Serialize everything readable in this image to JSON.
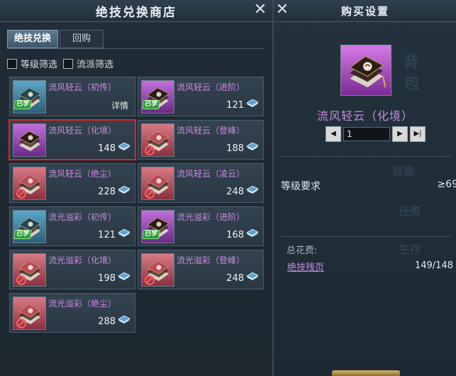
{
  "shop": {
    "title": "绝技兑换商店",
    "tabs": [
      "绝技兑换",
      "回购"
    ],
    "filters": [
      "等级筛选",
      "流派筛选"
    ],
    "items": [
      {
        "name": "流风轻云（初传）",
        "learned": "已学",
        "detail": "详情",
        "icon": "book-blue"
      },
      {
        "name": "流风轻云（进阶）",
        "learned": "已学",
        "price": "121",
        "icon": "book-purple"
      },
      {
        "name": "流风轻云（化境）",
        "price": "148",
        "selected": true,
        "icon": "book-dark"
      },
      {
        "name": "流风轻云（登峰）",
        "price": "188",
        "locked": true,
        "icon": "book-red"
      },
      {
        "name": "流风轻云（绝尘）",
        "price": "228",
        "locked": true,
        "icon": "book-red"
      },
      {
        "name": "流风轻云（凌云）",
        "price": "248",
        "locked": true,
        "icon": "book-red"
      },
      {
        "name": "流光溢彩（初传）",
        "learned": "已学",
        "price": "121",
        "icon": "book-blue"
      },
      {
        "name": "流光溢彩（进阶）",
        "learned": "已学",
        "price": "168",
        "icon": "book-purple"
      },
      {
        "name": "流光溢彩（化境）",
        "price": "198",
        "locked": true,
        "icon": "book-red"
      },
      {
        "name": "流光溢彩（登峰）",
        "price": "248",
        "locked": true,
        "icon": "book-red"
      },
      {
        "name": "流光溢彩（绝尘）",
        "price": "288",
        "locked": true,
        "icon": "book-red"
      }
    ]
  },
  "buy": {
    "title": "购买设置",
    "item_name": "流风轻云（化境）",
    "quantity": "1",
    "level_req_label": "等级要求",
    "level_req_value": "≥69",
    "total_cost_label": "总花费:",
    "currency_name": "绝技残页",
    "cost_value": "149/148",
    "watermarks": [
      "背",
      "包",
      "技能",
      "任务",
      "生存"
    ]
  },
  "colors": {
    "panel_bg": "#1f2b35",
    "purple_text": "#c88be0",
    "selected_border": "#e02424",
    "learned_green": "#2f9b3a"
  }
}
